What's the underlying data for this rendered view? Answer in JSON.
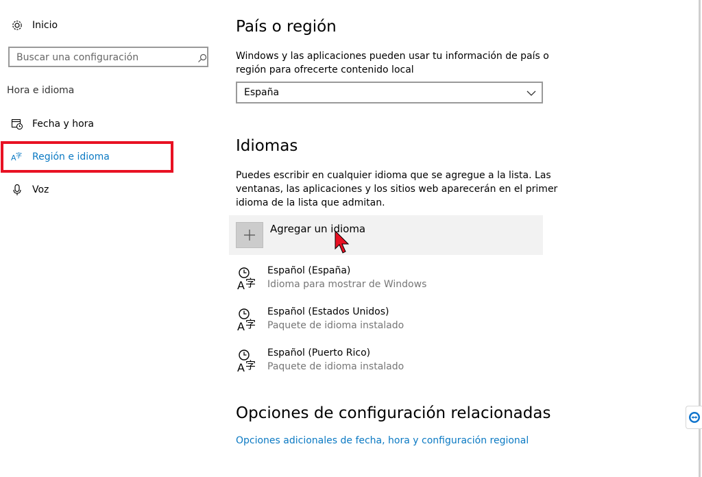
{
  "sidebar": {
    "home_label": "Inicio",
    "search": {
      "placeholder": "Buscar una configuración",
      "value": ""
    },
    "section_title": "Hora e idioma",
    "items": [
      {
        "label": "Fecha y hora",
        "icon": "calendar-clock-icon",
        "selected": false
      },
      {
        "label": "Región e idioma",
        "icon": "language-icon",
        "selected": true
      },
      {
        "label": "Voz",
        "icon": "microphone-icon",
        "selected": false
      }
    ]
  },
  "main": {
    "region": {
      "title": "País o región",
      "description_line1": "Windows y las aplicaciones pueden usar tu información de país o",
      "description_line2": "región para ofrecerte contenido local",
      "selected_country": "España"
    },
    "languages": {
      "title": "Idiomas",
      "description_line1": "Puedes escribir en cualquier idioma que se agregue a la lista. Las",
      "description_line2": "ventanas, las aplicaciones y los sitios web aparecerán en el primer",
      "description_line3": "idioma de la lista que admitan.",
      "add_label": "Agregar un idioma",
      "items": [
        {
          "name": "Español (España)",
          "status": "Idioma para mostrar de Windows"
        },
        {
          "name": "Español (Estados Unidos)",
          "status": "Paquete de idioma instalado"
        },
        {
          "name": "Español (Puerto Rico)",
          "status": "Paquete de idioma instalado"
        }
      ]
    },
    "related": {
      "title": "Opciones de configuración relacionadas",
      "link": "Opciones adicionales de fecha, hora y configuración regional"
    }
  },
  "colors": {
    "accent": "#0a79c3",
    "highlight": "#e81123",
    "cursor": "#e81123"
  }
}
